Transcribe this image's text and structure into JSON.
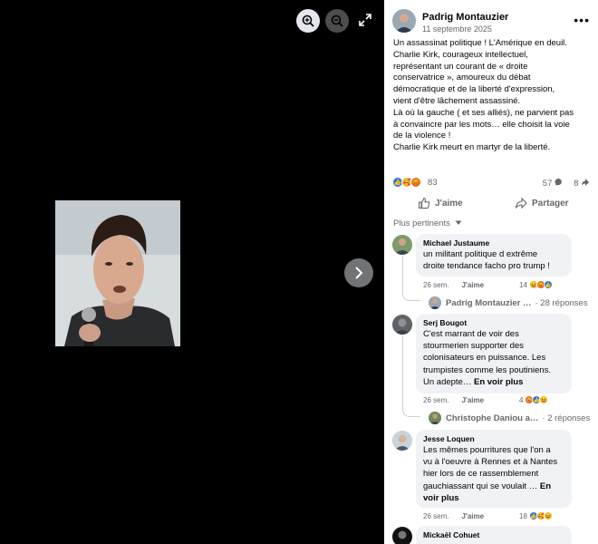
{
  "post": {
    "author": "Padrig Montauzier",
    "date": "11 septembre 2025",
    "text_lines": [
      "Un assassinat politique ! L'Amérique en deuil.",
      "Charlie Kirk, courageux intellectuel,",
      "représentant un courant de « droite",
      "conservatrice », amoureux du débat",
      "démocratique et de la liberté d'expression,",
      "vient d'être lâchement assassiné.",
      "Là où la gauche ( et ses alliés), ne parvient pas",
      "à convaincre par les mots… elle choisit la voie",
      "de la violence !",
      "Charlie Kirk meurt en martyr de la liberté."
    ],
    "reaction_count": "83",
    "comment_count": "57",
    "share_count": "8"
  },
  "actions": {
    "like": "J'aime",
    "share": "Partager"
  },
  "sort_label": "Plus pertinents",
  "comments": [
    {
      "name": "Michael Justaume",
      "lines": [
        "un militant politique d extrême",
        "droite tendance facho pro trump !"
      ],
      "time": "26 sem.",
      "like": "J'aime",
      "reactions": "14",
      "reply_author": "Padrig Montauzier …",
      "reply_count": "· 28 réponses"
    },
    {
      "name": "Serj Bougot",
      "lines": [
        "C'est marrant de voir des",
        "stourmerien supporter des",
        "colonisateurs en puissance. Les",
        "trumpistes comme les poutiniens.",
        "Un adepte…"
      ],
      "see_more": "En voir plus",
      "time": "26 sem.",
      "like": "J'aime",
      "reactions": "4",
      "reply_author": "Christophe Daniou a…",
      "reply_count": "· 2 réponses"
    },
    {
      "name": "Jesse Loquen",
      "lines": [
        "Les mêmes pourritures que l'on a",
        "vu à l'oeuvre à Rennes et à Nantes",
        "hier lors de ce rassemblement",
        "gauchiassant qui se voulait …"
      ],
      "see_more_a": "En",
      "see_more_b": "voir plus",
      "time": "26 sem.",
      "like": "J'aime",
      "reactions": "18"
    },
    {
      "name": "Mickaël Cohuet"
    }
  ],
  "colors": {
    "accent": "#1877f2",
    "secondary_text": "#65676b",
    "bubble": "#f0f2f5"
  }
}
